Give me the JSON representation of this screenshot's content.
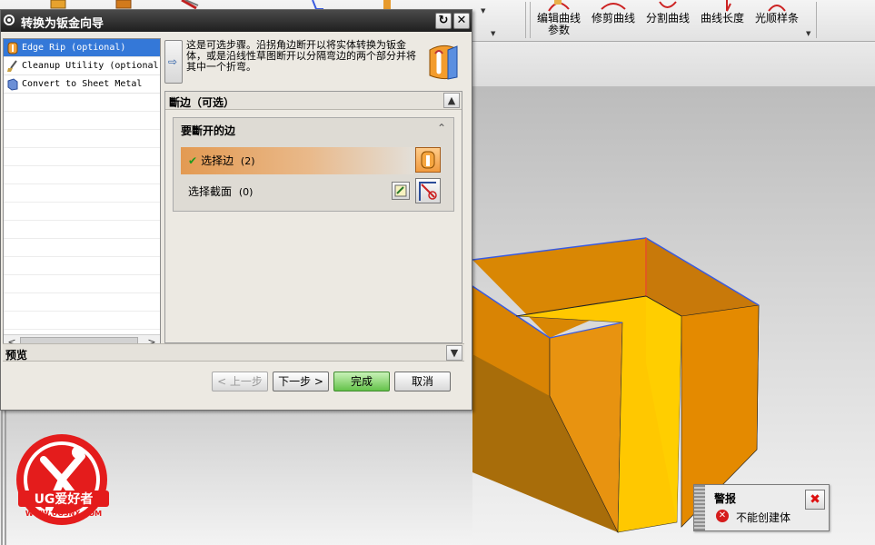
{
  "ribbon": {
    "edit_curve_params": "编辑曲线",
    "edit_curve_params_line2": "参数",
    "trim_curve": "修剪曲线",
    "divide_curve": "分割曲线",
    "curve_length": "曲线长度",
    "smooth_spline": "光顺样条"
  },
  "dialog": {
    "title": "转换为钣金向导",
    "steps": [
      {
        "label": "Edge Rip (optional)",
        "icon": "edge-rip-icon",
        "selected": true
      },
      {
        "label": "Cleanup Utility (optional)",
        "icon": "broom-icon",
        "selected": false
      },
      {
        "label": "Convert to Sheet Metal",
        "icon": "sheet-metal-icon",
        "selected": false
      }
    ],
    "description": "这是可选步骤。沿拐角边断开以将实体转换为钣金体，或是沿线性草图断开以分隔弯边的两个部分并将其中一个折弯。",
    "section_title": "斷边（可选）",
    "group_title": "要斷开的边",
    "select_edge_label": "选择边",
    "select_edge_count": "(2)",
    "select_section_label": "选择截面",
    "select_section_count": "(0)",
    "preview_label": "预览",
    "buttons": {
      "back": "< 上一步",
      "next": "下一步 >",
      "finish": "完成",
      "cancel": "取消"
    }
  },
  "warning": {
    "title": "警报",
    "message": "不能创建体"
  },
  "logo": {
    "brand": "UG爱好者",
    "url": "WWW.UGSNX.COM"
  },
  "colors": {
    "accent_orange": "#e39a52",
    "model_orange": "#e48a00",
    "model_yellow": "#ffc800",
    "edge_blue": "#3a5be0",
    "error_red": "#d51c1c"
  }
}
